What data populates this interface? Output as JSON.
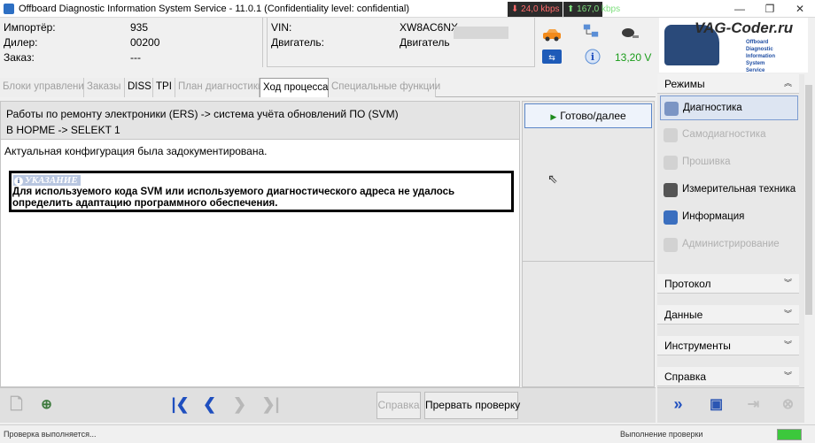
{
  "window": {
    "title": "Offboard Diagnostic Information System Service - 11.0.1 (Confidentiality level: confidential)",
    "controls": {
      "minimize": "—",
      "maximize": "❐",
      "close": "✕"
    }
  },
  "network": {
    "down": "⬇ 24,0 kbps",
    "up": "⬆ 167,0 kbps"
  },
  "header": {
    "importer_label": "Импортёр:",
    "importer_value": "935",
    "dealer_label": "Дилер:",
    "dealer_value": "00200",
    "order_label": "Заказ:",
    "order_value": "---",
    "vin_label": "VIN:",
    "vin_value": "XW8AC6NX",
    "engine_label": "Двигатель:",
    "engine_value": "Двигатель",
    "voltage": "13,20 V"
  },
  "logo": {
    "brand": "VAG-Coder.ru",
    "line1": "Offboard",
    "line2": "Diagnostic",
    "line3": "Information",
    "line4": "System",
    "line5": "Service"
  },
  "tabs": [
    {
      "label": "Блоки управления",
      "enabled": false
    },
    {
      "label": "Заказы",
      "enabled": false
    },
    {
      "label": "DISS",
      "enabled": true
    },
    {
      "label": "TPI",
      "enabled": true
    },
    {
      "label": "План диагностики",
      "enabled": false
    },
    {
      "label": "Ход процесса",
      "enabled": true,
      "active": true
    },
    {
      "label": "Специальные функции",
      "enabled": false
    }
  ],
  "process": {
    "path": "Работы по ремонту электроники (ERS) -> система учёта обновлений ПО (SVM)",
    "step": "В НОРМЕ -> SELEKT 1",
    "state": "Актуальная конфигурация была задокументирована.",
    "notice_title": "УКАЗАНИЕ",
    "notice_text": "Для используемого кода SVM или используемого диагностического адреса не удалось определить адаптацию программного обеспечения."
  },
  "actions": {
    "next_label": "Готово/далее"
  },
  "toolbar": {
    "help_label": "Справка",
    "abort_label": "Прервать проверку"
  },
  "sidebar": {
    "modes_title": "Режимы",
    "modes": [
      {
        "label": "Диагностика",
        "state": "active"
      },
      {
        "label": "Самодиагностика",
        "state": "disabled"
      },
      {
        "label": "Прошивка",
        "state": "disabled"
      },
      {
        "label": "Измерительная техника",
        "state": "enabled"
      },
      {
        "label": "Информация",
        "state": "enabled"
      },
      {
        "label": "Администрирование",
        "state": "disabled"
      }
    ],
    "sections": [
      {
        "label": "Протокол"
      },
      {
        "label": "Данные"
      },
      {
        "label": "Инструменты"
      },
      {
        "label": "Справка"
      }
    ]
  },
  "status": {
    "left": "Проверка выполняется...",
    "right": "Выполнение проверки"
  },
  "colors": {
    "accent": "#1f4fbf",
    "voltage": "#1a9c1a",
    "notice_head": "#b8c6e0"
  }
}
